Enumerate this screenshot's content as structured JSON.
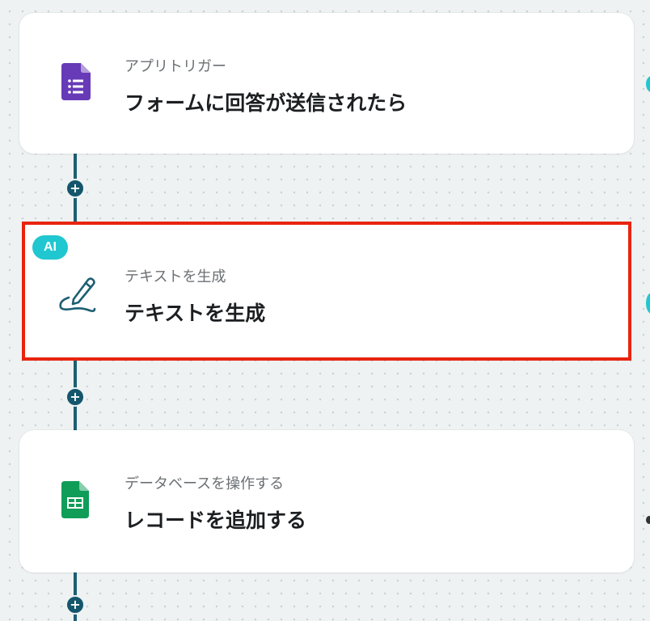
{
  "flow": {
    "steps": [
      {
        "subtitle": "アプリトリガー",
        "title": "フォームに回答が送信されたら",
        "icon": "google-forms-icon",
        "color": "#673ab7"
      },
      {
        "subtitle": "テキストを生成",
        "title": "テキストを生成",
        "icon": "pen-signature-icon",
        "badge": "AI",
        "color": "#1d5f73",
        "selected": true
      },
      {
        "subtitle": "データベースを操作する",
        "title": "レコードを追加する",
        "icon": "google-sheets-icon",
        "color": "#0f9d58"
      }
    ],
    "add_button_label": "+"
  },
  "colors": {
    "connector": "#1d5f73",
    "highlight": "#e8240f",
    "ai_badge": "#20c7d0"
  }
}
